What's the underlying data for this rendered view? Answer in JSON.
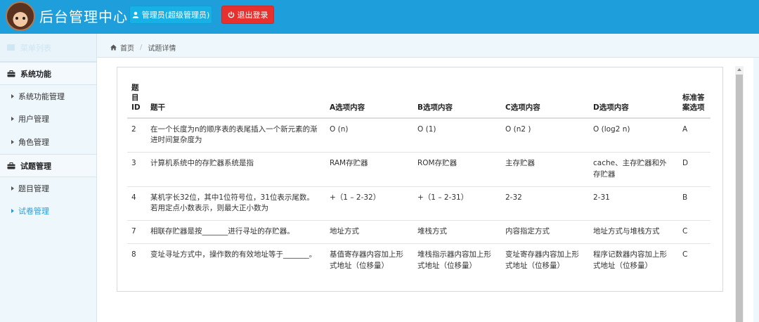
{
  "header": {
    "title": "后台管理中心",
    "admin_button": "管理员(超级管理员)",
    "logout_button": "退出登录"
  },
  "breadcrumb": {
    "home": "首页",
    "current": "试题详情"
  },
  "sidebar": {
    "top_label": "菜单列表",
    "groups": [
      {
        "label": "系统功能",
        "items": [
          {
            "label": "系统功能管理"
          },
          {
            "label": "用户管理"
          },
          {
            "label": "角色管理"
          }
        ]
      },
      {
        "label": "试题管理",
        "items": [
          {
            "label": "题目管理"
          },
          {
            "label": "试卷管理"
          }
        ]
      }
    ]
  },
  "table": {
    "headers": {
      "id": "题\n目\nID",
      "stem": "题干",
      "a": "A选项内容",
      "b": "B选项内容",
      "c": "C选项内容",
      "d": "D选项内容",
      "answer": "标准答\n案选项"
    },
    "rows": [
      {
        "id": "2",
        "stem": "在一个长度为n的顺序表的表尾插入一个新元素的渐进时间复杂度为",
        "a": "O (n)",
        "b": "O (1)",
        "c": "O (n2 )",
        "d": "O (log2 n)",
        "answer": "A"
      },
      {
        "id": "3",
        "stem": "计算机系统中的存贮器系统是指",
        "a": "RAM存贮器",
        "b": "ROM存贮器",
        "c": "主存贮器",
        "d": "cache、主存贮器和外存贮器",
        "answer": "D"
      },
      {
        "id": "4",
        "stem": "某机字长32位，其中1位符号位，31位表示尾数。若用定点小数表示，则最大正小数为",
        "a": "+（1 – 2-32）",
        "b": "+（1 – 2-31）",
        "c": "2-32",
        "d": "2-31",
        "answer": "B"
      },
      {
        "id": "7",
        "stem": "相联存贮器是按_______进行寻址的存贮器。",
        "a": "地址方式",
        "b": "堆栈方式",
        "c": "内容指定方式",
        "d": "地址方式与堆栈方式",
        "answer": "C"
      },
      {
        "id": "8",
        "stem": "变址寻址方式中，操作数的有效地址等于_______。",
        "a": "基值寄存器内容加上形式地址（位移量）",
        "b": "堆栈指示器内容加上形式地址（位移量）",
        "c": "变址寄存器内容加上形式地址（位移量）",
        "d": "程序记数器内容加上形式地址（位移量）",
        "answer": "C"
      }
    ]
  }
}
